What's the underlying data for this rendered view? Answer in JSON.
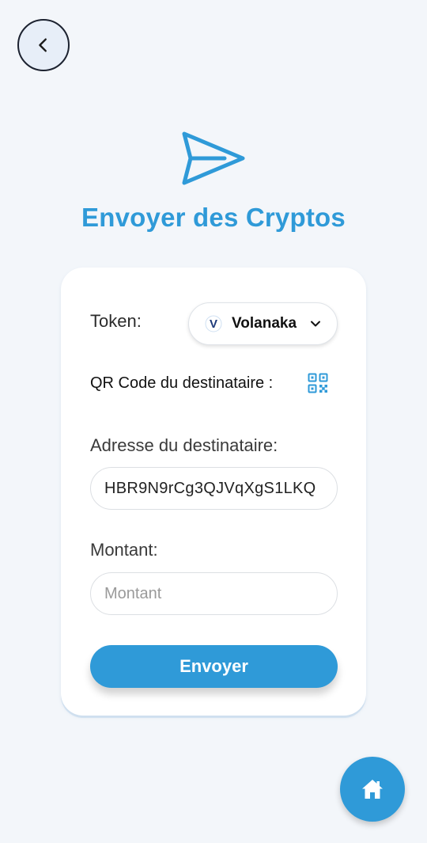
{
  "header": {
    "back_icon": "chevron-left-icon",
    "send_icon": "paper-plane-icon",
    "title": "Envoyer des Cryptos"
  },
  "form": {
    "token_label": "Token:",
    "token": {
      "selected": "Volanaka",
      "logo_letter": "V",
      "icon": "chevron-down-icon"
    },
    "qr_label": "QR Code du destinataire :",
    "qr_icon": "qr-code-icon",
    "address_label": "Adresse du destinataire:",
    "address_value": "HBR9N9rCg3QJVqXgS1LKQ",
    "amount_label": "Montant:",
    "amount_placeholder": "Montant",
    "amount_value": "",
    "submit_label": "Envoyer"
  },
  "fab": {
    "icon": "home-icon"
  },
  "colors": {
    "accent": "#2f9ad8",
    "background": "#f3f6fa",
    "card": "#ffffff"
  }
}
